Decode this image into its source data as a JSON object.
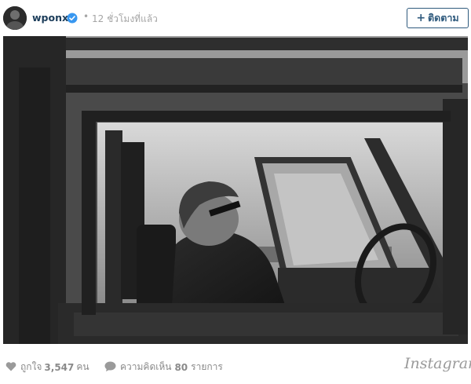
{
  "post": {
    "username": "wponx",
    "separator": "•",
    "time_ago": "12 ชั่วโมงที่แล้ว",
    "follow_label": "ติดตาม",
    "follow_plus": "+"
  },
  "stats": {
    "likes_prefix": "ถูกใจ",
    "likes_count": "3,547",
    "likes_suffix": "คน",
    "comments_prefix": "ความคิดเห็น",
    "comments_count": "80",
    "comments_suffix": "รายการ"
  },
  "brand": "Instagram",
  "icons": {
    "verified": "verified-badge-icon",
    "heart": "heart-icon",
    "comment": "comment-bubble-icon"
  },
  "colors": {
    "accent": "#2f5a7d",
    "verified": "#3897f0",
    "muted": "#a5a5a5"
  }
}
